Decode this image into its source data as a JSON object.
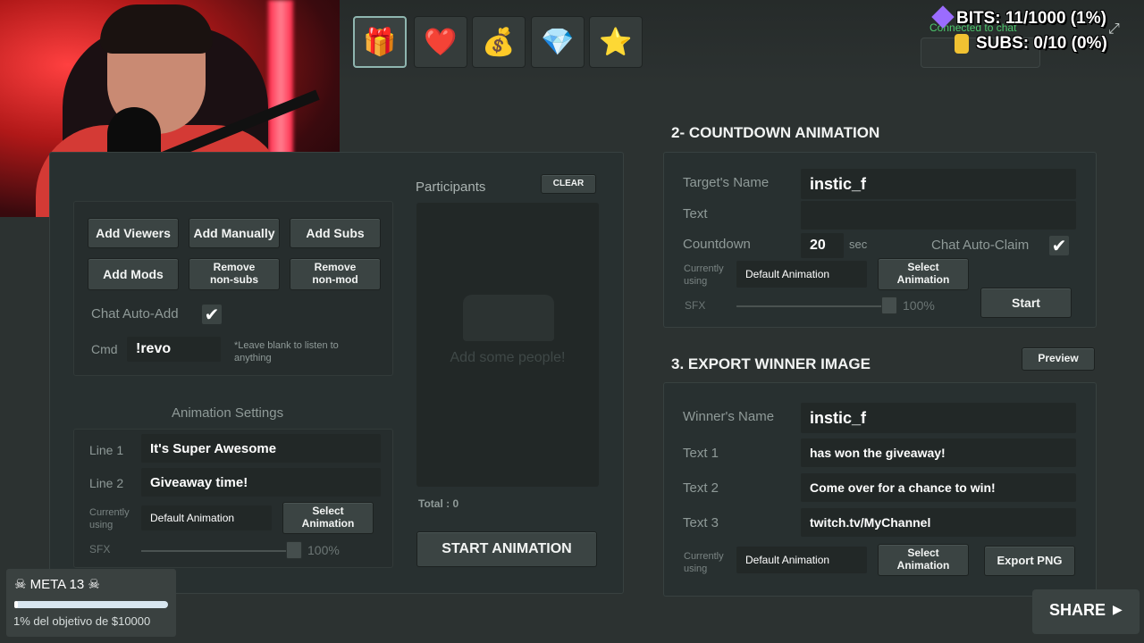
{
  "overlay": {
    "connected_text": "Connected to chat",
    "bits": "BITS: 11/1000 (1%)",
    "subs": "SUBS: 0/10 (0%)"
  },
  "toolbar": {
    "icons": [
      "gift-icon",
      "heart-icon",
      "money-icon",
      "gem-icon",
      "star-icon"
    ]
  },
  "add_panel": {
    "add_viewers": "Add Viewers",
    "add_manually": "Add Manually",
    "add_subs": "Add Subs",
    "add_mods": "Add Mods",
    "remove_nonsubs": "Remove non-subs",
    "remove_nonmod": "Remove non-mod",
    "chat_auto_add_label": "Chat Auto-Add",
    "cmd_label": "Cmd",
    "cmd_value": "!revo",
    "cmd_hint": "*Leave blank to listen to anything"
  },
  "participants": {
    "title": "Participants",
    "clear_label": "CLEAR",
    "empty_text": "Add some people!",
    "total": "Total : 0",
    "start_label": "START ANIMATION"
  },
  "animation_settings": {
    "title": "Animation Settings",
    "line1_label": "Line 1",
    "line1_value": "It's Super Awesome",
    "line2_label": "Line 2",
    "line2_value": "Giveaway time!",
    "currently_label": "Currently using",
    "current_animation": "Default Animation",
    "select_label": "Select Animation",
    "sfx_label": "SFX",
    "sfx_value": "100%"
  },
  "countdown": {
    "title": "2- COUNTDOWN ANIMATION",
    "target_label": "Target's Name",
    "target_value": "instic_f",
    "text_label": "Text",
    "text_value": "",
    "countdown_label": "Countdown",
    "countdown_value": "20",
    "countdown_unit": "sec",
    "auto_claim_label": "Chat Auto-Claim",
    "currently_label": "Currently using",
    "current_animation": "Default Animation",
    "select_label": "Select Animation",
    "sfx_label": "SFX",
    "sfx_value": "100%",
    "start_label": "Start"
  },
  "export": {
    "title": "3. EXPORT WINNER IMAGE",
    "preview_label": "Preview",
    "winner_label": "Winner's Name",
    "winner_value": "instic_f",
    "text1_label": "Text 1",
    "text1_value": "has won the giveaway!",
    "text2_label": "Text 2",
    "text2_value": "Come over for a chance to win!",
    "text3_label": "Text 3",
    "text3_value": "twitch.tv/MyChannel",
    "currently_label": "Currently using",
    "current_animation": "Default Animation",
    "select_label": "Select Animation",
    "export_label": "Export PNG"
  },
  "meta_goal": {
    "title": "META 13",
    "subtitle": "1% del objetivo de $10000",
    "progress_percent": 1
  },
  "share": {
    "label": "SHARE"
  }
}
